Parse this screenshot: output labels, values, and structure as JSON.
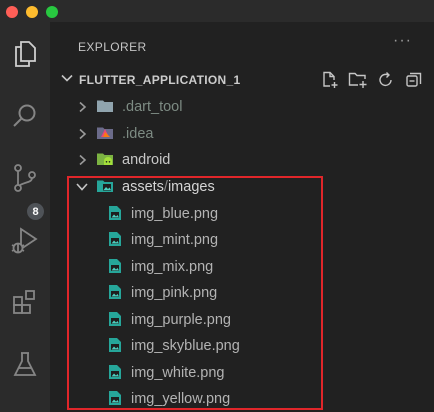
{
  "window": {
    "controls": [
      "close",
      "minimize",
      "maximize"
    ]
  },
  "activity_bar": {
    "items": [
      {
        "name": "explorer",
        "icon": "files-icon"
      },
      {
        "name": "search",
        "icon": "search-icon"
      },
      {
        "name": "source-control",
        "icon": "source-control-icon",
        "badge": "8"
      },
      {
        "name": "run-debug",
        "icon": "run-debug-icon"
      },
      {
        "name": "extensions",
        "icon": "extensions-icon"
      },
      {
        "name": "testing",
        "icon": "flask-icon"
      }
    ]
  },
  "explorer": {
    "header": "EXPLORER",
    "more": "···",
    "root": {
      "label": "FLUTTER_APPLICATION_1",
      "actions": [
        "new-file-icon",
        "new-folder-icon",
        "refresh-icon",
        "collapse-all-icon"
      ]
    },
    "folders": [
      {
        "label": ".dart_tool",
        "icon": "folder-icon"
      },
      {
        "label": ".idea",
        "icon": "idea-folder-icon"
      },
      {
        "label": "android",
        "icon": "android-folder-icon"
      }
    ],
    "open_folder": {
      "part1": "assets",
      "separator": "/",
      "part2": "images",
      "icon": "image-folder-icon"
    },
    "files": [
      "img_blue.png",
      "img_mint.png",
      "img_mix.png",
      "img_pink.png",
      "img_purple.png",
      "img_skyblue.png",
      "img_white.png",
      "img_yellow.png"
    ]
  },
  "colors": {
    "accent_highlight": "#e0262a",
    "image_icon": "#26a69a",
    "folder_gray": "#90a4ae"
  }
}
